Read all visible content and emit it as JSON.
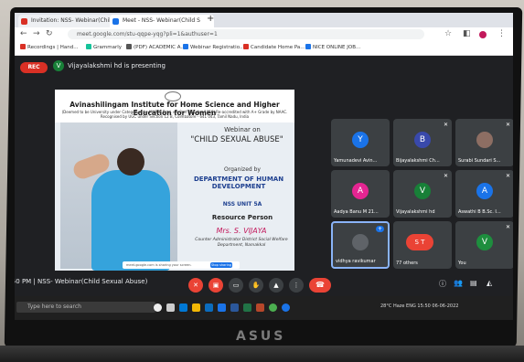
{
  "browser": {
    "tabs": [
      {
        "label": "Invitation: NSS- Webinar(Child",
        "color": "#d93025"
      },
      {
        "label": "Meet - NSS- Webinar(Child S",
        "color": "#1a73e8",
        "active": true
      }
    ],
    "new_tab": "+",
    "url": "meet.google.com/stu-qqpe-yqg?pli=1&authuser=1",
    "bookmarks": [
      {
        "label": "Recordings | Hand...",
        "color": "#d93025"
      },
      {
        "label": "Grammarly",
        "color": "#15c39a"
      },
      {
        "label": "(PDF) ACADEMIC A...",
        "color": "#555555"
      },
      {
        "label": "Webinar Registratio...",
        "color": "#1a73e8"
      },
      {
        "label": "Candidate Home Pa...",
        "color": "#d93025"
      },
      {
        "label": "NICE ONLINE JOB...",
        "color": "#1a73e8"
      }
    ]
  },
  "meet": {
    "rec_label": "REC",
    "presenter_initial": "V",
    "presenting_text": "Vijayalakshmi hd is presenting",
    "meeting_name": "3:50 PM  |  NSS- Webinar(Child Sexual Abuse)",
    "slide": {
      "institute": "Avinashilingam Institute for Home Science and Higher Education for Women",
      "institute_sub": "(Deemed to be University under Category A by MHRD, Estd. u/s 3 of UGC Act 1956) Re-accredited with A+ Grade by NAAC. Recognised by UGC under Section 12 B, Coimbatore - 641 043, Tamil Nadu, India",
      "webinar_on": "Webinar on",
      "topic": "\"CHILD SEXUAL ABUSE\"",
      "organized_by": "Organized by",
      "department": "DEPARTMENT OF HUMAN DEVELOPMENT",
      "unit": "NSS UNIT 5A",
      "resource_person": "Resource Person",
      "speaker": "Mrs. S. VIJAYA",
      "speaker_role": "Counter Administrator District Social Welfare Department, Namakkal",
      "sharing_text": "meet.google.com is sharing your screen.",
      "stop_sharing": "Stop sharing"
    },
    "participants": [
      {
        "name": "Yamunadevi Avin...",
        "initial": "Y",
        "color": "#1a73e8",
        "muted": false
      },
      {
        "name": "Bijayalakshmi Ch...",
        "initial": "B",
        "color": "#3949ab",
        "muted": true
      },
      {
        "name": "Surabi Sundari S...",
        "initial": "",
        "color": "#8d6e63",
        "muted": true
      },
      {
        "name": "Aadya Banu M 21...",
        "initial": "A",
        "color": "#e52592",
        "muted": false
      },
      {
        "name": "Vijayalakshmi hd",
        "initial": "V",
        "color": "#188038",
        "muted": true
      },
      {
        "name": "Aswathi B B.Sc. I...",
        "initial": "A",
        "color": "#1a73e8",
        "muted": true
      },
      {
        "name": "vidhya ravikumar",
        "initial": "",
        "color": "#5f6368",
        "muted": false
      },
      {
        "name": "77 others",
        "initial": "S T",
        "color": "#ea4335",
        "muted": false
      },
      {
        "name": "You",
        "initial": "V",
        "color": "#1e8e3e",
        "muted": true
      }
    ]
  },
  "taskbar": {
    "search_placeholder": "Type here to search",
    "tray_text": "28°C  Haze  ENG  15:50  06-06-2022"
  },
  "brand": "ASUS"
}
